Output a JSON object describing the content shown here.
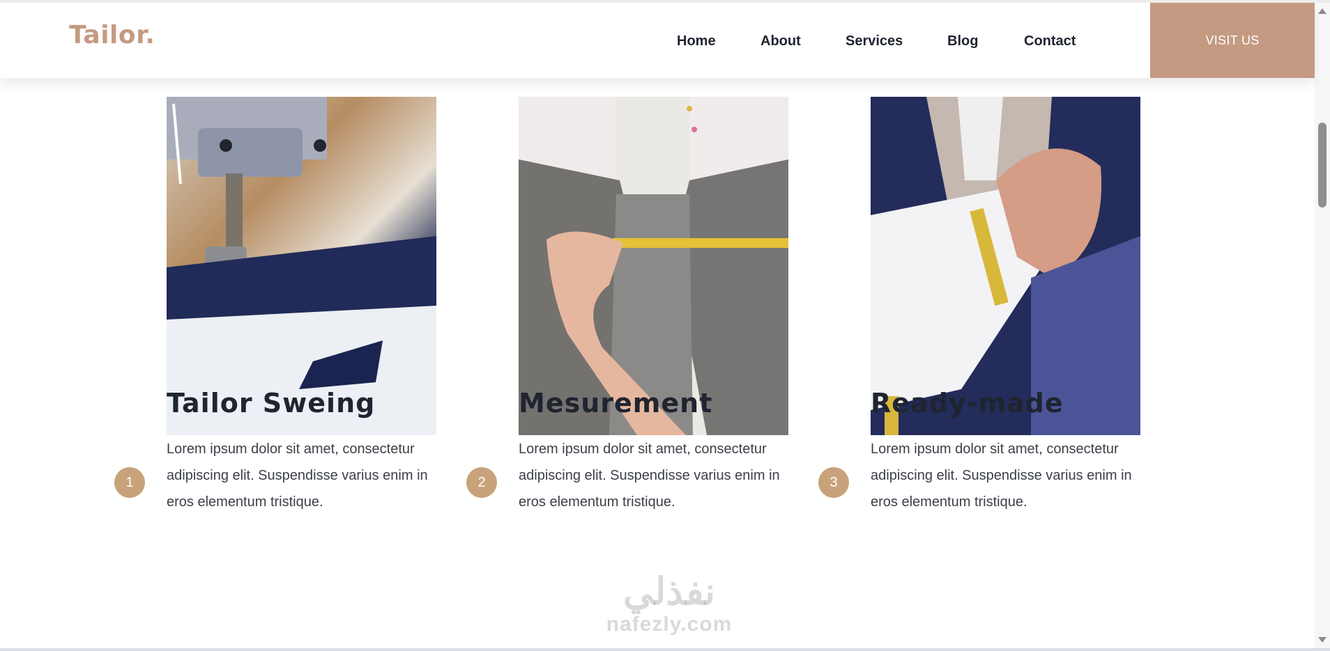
{
  "header": {
    "logo": "Tailor.",
    "nav": [
      "Home",
      "About",
      "Services",
      "Blog",
      "Contact"
    ],
    "cta_label": "VISIT US"
  },
  "services": [
    {
      "step": "1",
      "title": "Tailor Sweing",
      "text": "Lorem ipsum dolor sit amet, consectetur adipiscing elit. Suspendisse varius enim in eros elementum tristique."
    },
    {
      "step": "2",
      "title": "Mesurement",
      "text": "Lorem ipsum dolor sit amet, consectetur adipiscing elit. Suspendisse varius enim in eros elementum tristique."
    },
    {
      "step": "3",
      "title": "Ready-made",
      "text": "Lorem ipsum dolor sit amet, consectetur adipiscing elit. Suspendisse varius enim in eros elementum tristique."
    }
  ],
  "watermark": {
    "arabic": "نفذلي",
    "latin": "nafezly.com"
  },
  "colors": {
    "accent": "#c49a82",
    "badge": "#c8a27a",
    "text": "#1f2430"
  },
  "icons": {
    "scroll_up": "triangle-up",
    "scroll_down": "triangle-down"
  }
}
